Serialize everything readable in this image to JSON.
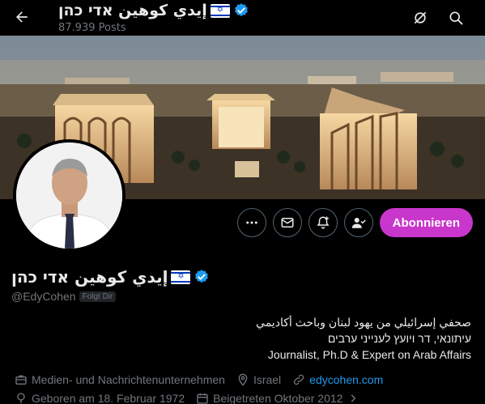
{
  "header": {
    "display_name": "إيدي كوهين אדי כהן",
    "post_count": "87.939 Posts"
  },
  "profile": {
    "display_name": "إيدي كوهين אדי כהן",
    "handle": "@EdyCohen",
    "follows_badge": "Folgt Dir",
    "bio": [
      "صحفي إسرائيلي من يهود لبنان وباحث أكاديمي",
      "עיתונאי, דר ויועץ לענייני ערבים",
      "Journalist, Ph.D & Expert on Arab Affairs"
    ],
    "category": "Medien- und Nachrichtenunternehmen",
    "location": "Israel",
    "website": "edycohen.com",
    "birthday": "Geboren am 18. Februar 1972",
    "joined": "Beigetreten Oktober 2012"
  },
  "actions": {
    "subscribe_label": "Abonnieren"
  },
  "icons": {
    "back": "arrow-left-icon",
    "grok": "grok-icon",
    "search": "search-icon",
    "more": "more-icon",
    "message": "envelope-icon",
    "notify": "bell-plus-icon",
    "follow": "person-check-icon",
    "verified": "verified-badge-icon",
    "flag": "israel-flag-icon"
  },
  "colors": {
    "accent": "#c936cc",
    "link": "#1d9bf0",
    "verified": "#1d9bf0"
  }
}
